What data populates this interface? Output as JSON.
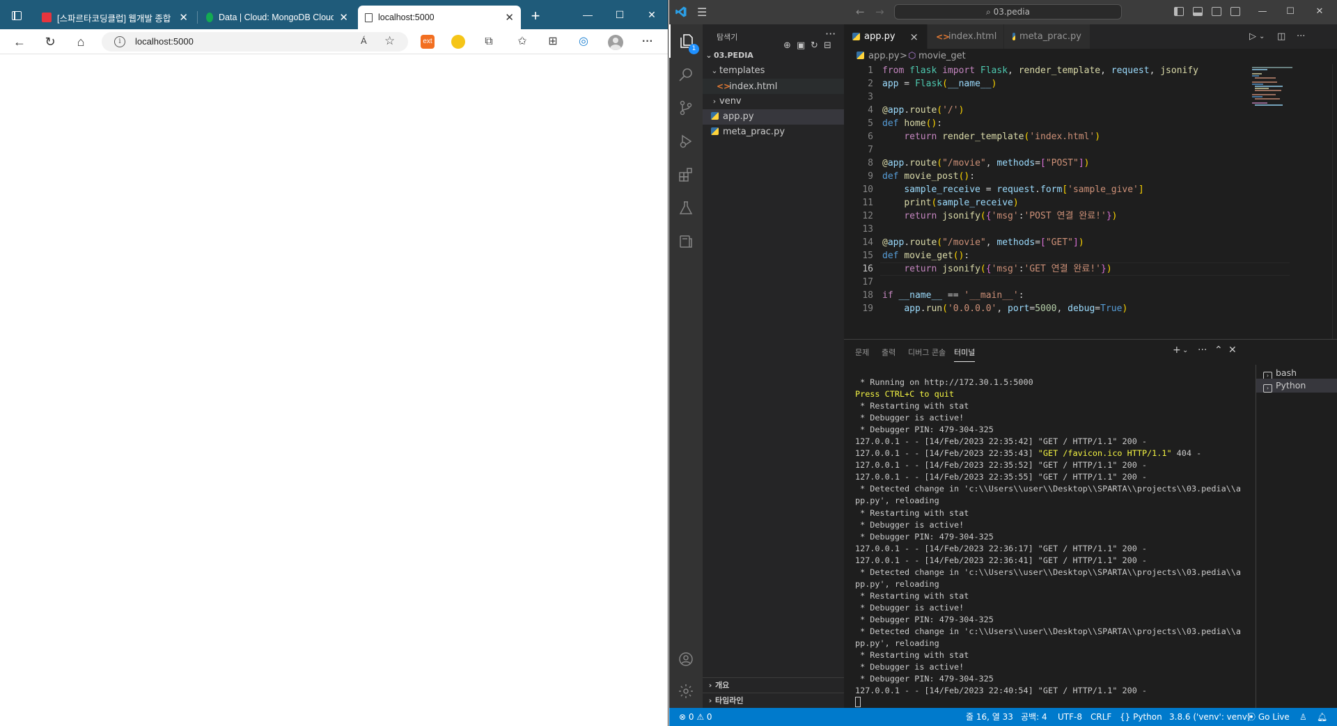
{
  "browser": {
    "tabs": [
      {
        "title": "[스파르타코딩클럽] 웹개발 종합",
        "favicon_color": "#e5353e"
      },
      {
        "title": "Data | Cloud: MongoDB Cloud",
        "favicon_color": "#13aa52"
      },
      {
        "title": "localhost:5000",
        "favicon_color": "#ffffff"
      }
    ],
    "new_tab": "+",
    "window_controls": {
      "minimize": "—",
      "maximize": "☐",
      "close": "✕"
    },
    "address": {
      "url": "localhost:5000",
      "read_aloud": "Á"
    },
    "extension_colors": {
      "ext1": "#f26f21",
      "ext2": "#f5c518"
    }
  },
  "vscode": {
    "command_center": "⌕ 03.pedia",
    "explorer": {
      "header": "탐색기",
      "root": "03.PEDIA",
      "items": [
        {
          "name": "templates",
          "type": "folder",
          "open": true,
          "depth": 1
        },
        {
          "name": "index.html",
          "type": "html",
          "depth": 2
        },
        {
          "name": "venv",
          "type": "folder",
          "open": false,
          "depth": 1
        },
        {
          "name": "app.py",
          "type": "py",
          "depth": 1,
          "selected": true
        },
        {
          "name": "meta_prac.py",
          "type": "py",
          "depth": 1
        }
      ],
      "outline": "개요",
      "timeline": "타임라인"
    },
    "badge_count": "1",
    "tabs": [
      {
        "label": "app.py",
        "active": true,
        "indicator": "×"
      },
      {
        "label": "index.html",
        "active": false,
        "indicator": "dirty"
      },
      {
        "label": "meta_prac.py",
        "active": false,
        "indicator": ""
      }
    ],
    "breadcrumb": {
      "file": "app.py",
      "sep": ">",
      "symbol": "movie_get"
    },
    "current_line": 16,
    "panel": {
      "tabs": [
        "문제",
        "출력",
        "디버그 콘솔",
        "터미널"
      ],
      "active_tab": "터미널",
      "terminals": [
        "bash",
        "Python"
      ],
      "output": [
        {
          "text": " * Running on http://172.30.1.5:5000",
          "hl": false
        },
        {
          "text": "Press CTRL+C to quit",
          "hl": true
        },
        {
          "text": " * Restarting with stat",
          "hl": false
        },
        {
          "text": " * Debugger is active!",
          "hl": false
        },
        {
          "text": " * Debugger PIN: 479-304-325",
          "hl": false
        },
        {
          "text": "127.0.0.1 - - [14/Feb/2023 22:35:42] \"GET / HTTP/1.1\" 200 -",
          "hl": false
        },
        {
          "text": "127.0.0.1 - - [14/Feb/2023 22:35:43] ",
          "hl": false,
          "yellow": "\"GET /favicon.ico HTTP/1.1\"",
          "after": " 404 -"
        },
        {
          "text": "127.0.0.1 - - [14/Feb/2023 22:35:52] \"GET / HTTP/1.1\" 200 -",
          "hl": false
        },
        {
          "text": "127.0.0.1 - - [14/Feb/2023 22:35:55] \"GET / HTTP/1.1\" 200 -",
          "hl": false
        },
        {
          "text": " * Detected change in 'c:\\\\Users\\\\user\\\\Desktop\\\\SPARTA\\\\projects\\\\03.pedia\\\\a",
          "hl": false
        },
        {
          "text": "pp.py', reloading",
          "hl": false
        },
        {
          "text": " * Restarting with stat",
          "hl": false
        },
        {
          "text": " * Debugger is active!",
          "hl": false
        },
        {
          "text": " * Debugger PIN: 479-304-325",
          "hl": false
        },
        {
          "text": "127.0.0.1 - - [14/Feb/2023 22:36:17] \"GET / HTTP/1.1\" 200 -",
          "hl": false
        },
        {
          "text": "127.0.0.1 - - [14/Feb/2023 22:36:41] \"GET / HTTP/1.1\" 200 -",
          "hl": false
        },
        {
          "text": " * Detected change in 'c:\\\\Users\\\\user\\\\Desktop\\\\SPARTA\\\\projects\\\\03.pedia\\\\a",
          "hl": false
        },
        {
          "text": "pp.py', reloading",
          "hl": false
        },
        {
          "text": " * Restarting with stat",
          "hl": false
        },
        {
          "text": " * Debugger is active!",
          "hl": false
        },
        {
          "text": " * Debugger PIN: 479-304-325",
          "hl": false
        },
        {
          "text": " * Detected change in 'c:\\\\Users\\\\user\\\\Desktop\\\\SPARTA\\\\projects\\\\03.pedia\\\\a",
          "hl": false
        },
        {
          "text": "pp.py', reloading",
          "hl": false
        },
        {
          "text": " * Restarting with stat",
          "hl": false
        },
        {
          "text": " * Debugger is active!",
          "hl": false
        },
        {
          "text": " * Debugger PIN: 479-304-325",
          "hl": false
        },
        {
          "text": "127.0.0.1 - - [14/Feb/2023 22:40:54] \"GET / HTTP/1.1\" 200 -",
          "hl": false
        }
      ]
    },
    "status": {
      "problems": "⊗ 0 ⚠ 0",
      "position": "줄 16, 열 33",
      "indent": "공백: 4",
      "encoding": "UTF-8",
      "eol": "CRLF",
      "language": "{} Python",
      "interpreter": "3.8.6 ('venv': venv)",
      "live": "⦿ Go Live"
    }
  }
}
